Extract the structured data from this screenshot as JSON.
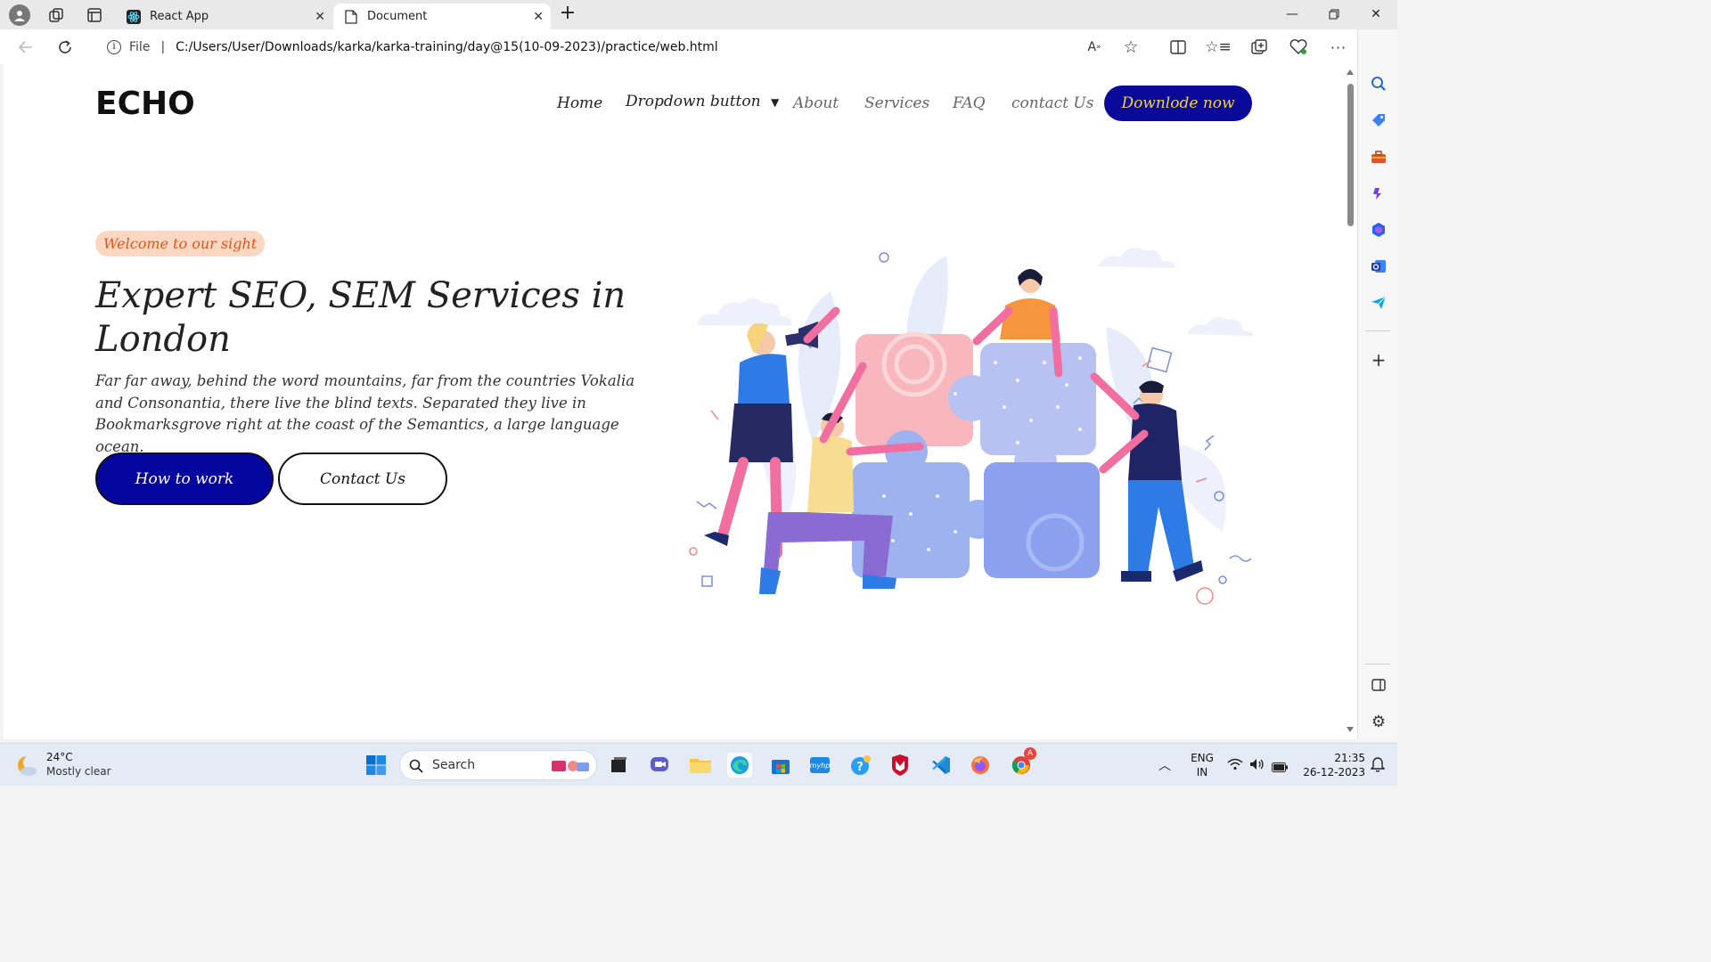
{
  "browser": {
    "tabs": [
      {
        "title": "React App"
      },
      {
        "title": "Document"
      }
    ],
    "address": {
      "file_label": "File",
      "url": "C:/Users/User/Downloads/karka/karka-training/day@15(10-09-2023)/practice/web.html"
    }
  },
  "site": {
    "logo": "ECHO",
    "nav": {
      "home": "Home",
      "dropdown": "Dropdown button",
      "about": "About",
      "services": "Services",
      "faq": "FAQ",
      "contact": "contact Us",
      "cta": "Downlode now"
    },
    "hero": {
      "badge": "Welcome to our sight",
      "title": "Expert SEO, SEM Services in London",
      "description": "Far far away, behind the word mountains, far from the countries Vokalia and Consonantia, there live the blind texts. Separated they live in Bookmarksgrove right at the coast of the Semantics, a large language ocean.",
      "primary_button": "How to work",
      "secondary_button": "Contact Us"
    }
  },
  "taskbar": {
    "weather": {
      "temp": "24°C",
      "condition": "Mostly clear"
    },
    "search_placeholder": "Search",
    "language": {
      "line1": "ENG",
      "line2": "IN"
    },
    "clock": {
      "time": "21:35",
      "date": "26-12-2023"
    },
    "chrome_badge": "A"
  },
  "colors": {
    "primary": "#0505a0",
    "cta_text": "#f7d23a",
    "badge_bg": "#fcd7c2",
    "badge_text": "#e4541c"
  }
}
